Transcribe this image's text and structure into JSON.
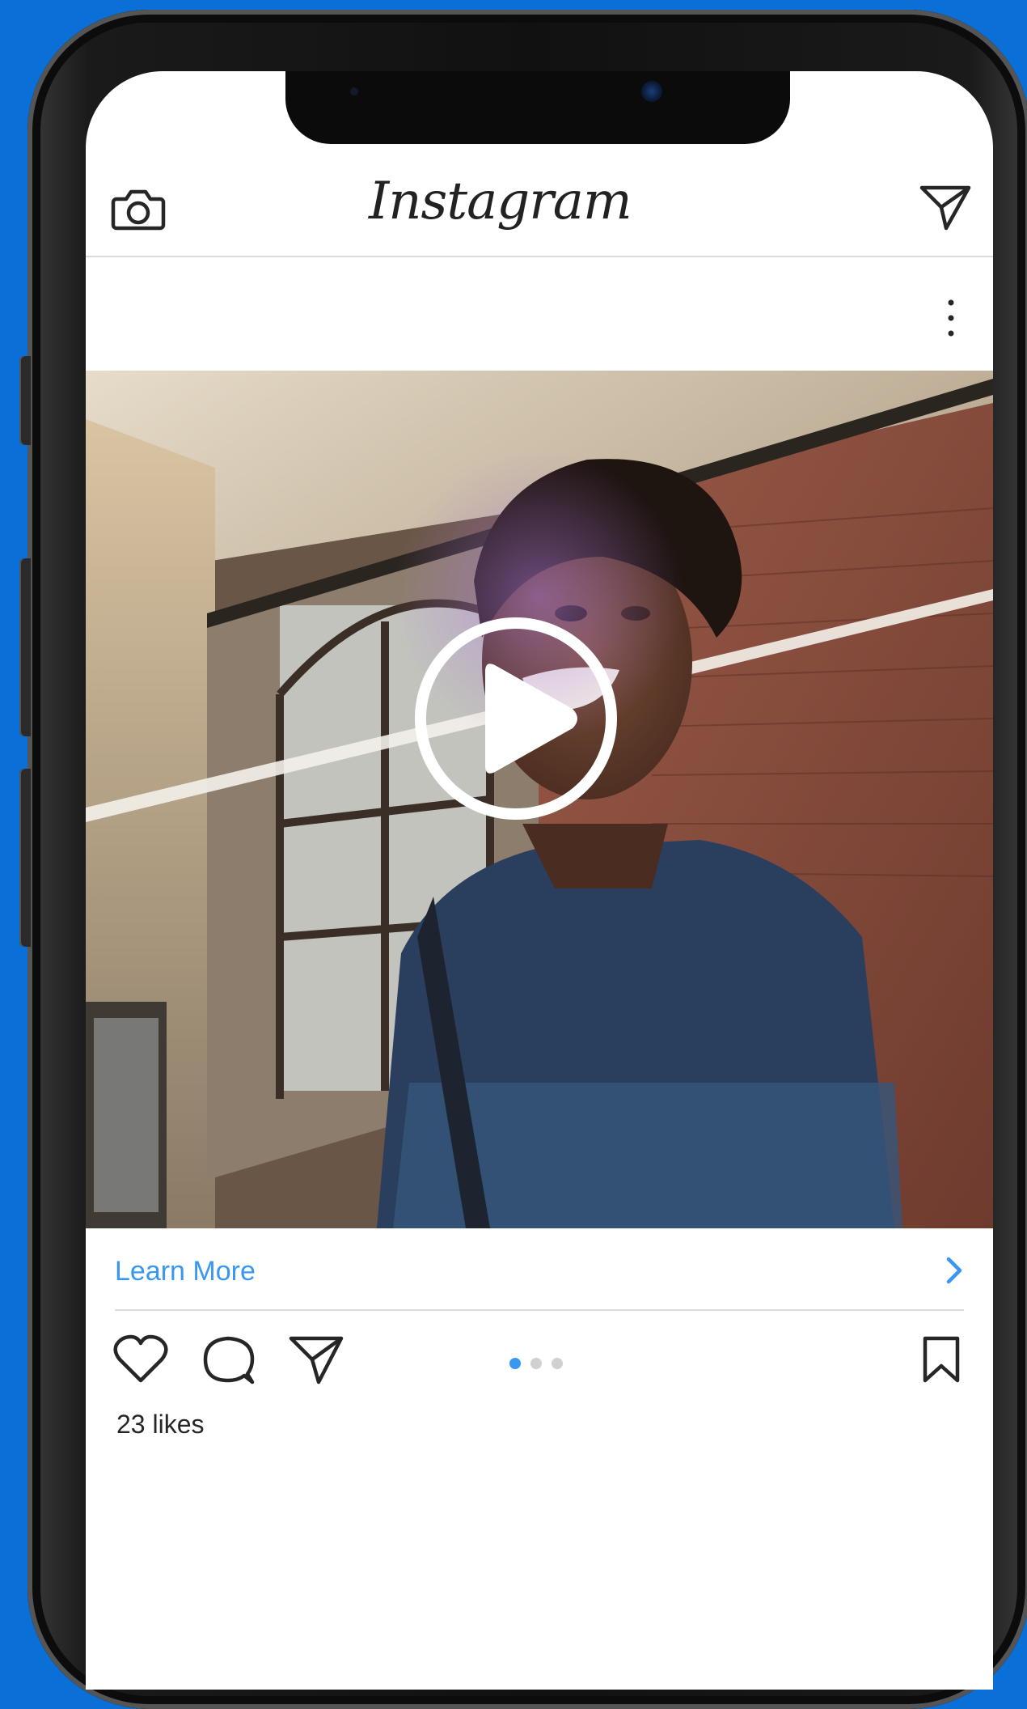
{
  "app": {
    "logo_text": "Instagram"
  },
  "post": {
    "cta_label": "Learn More",
    "likes_text": "23 likes",
    "carousel": {
      "total": 3,
      "active_index": 0
    }
  },
  "icons": {
    "camera": "camera-icon",
    "direct": "paper-plane-icon",
    "more": "vertical-ellipsis-icon",
    "play": "play-icon",
    "chevron": "chevron-right-icon",
    "like": "heart-icon",
    "comment": "comment-bubble-icon",
    "share": "paper-plane-icon",
    "save": "bookmark-icon"
  },
  "colors": {
    "background": "#0a6fd6",
    "link": "#3897f0",
    "text": "#262626",
    "divider": "#dbdbdb",
    "dot_active": "#3897f0",
    "dot_inactive": "#d0d0d0"
  }
}
